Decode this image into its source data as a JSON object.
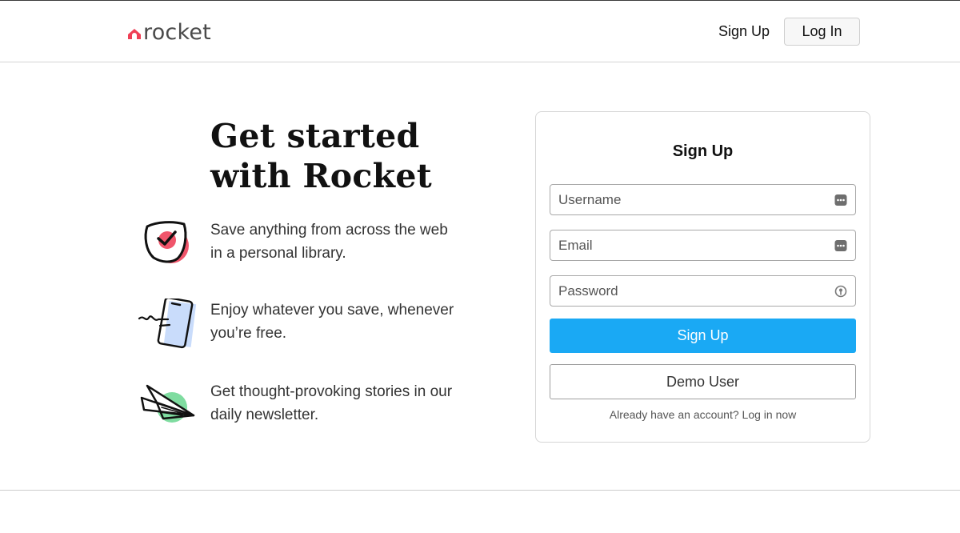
{
  "header": {
    "logo_text": "rocket",
    "nav_signup_label": "Sign Up",
    "nav_login_label": "Log In"
  },
  "hero": {
    "title_line1": "Get started",
    "title_line2": "with Rocket"
  },
  "features": [
    {
      "icon": "shield-check-icon",
      "text": "Save anything from across the web in a personal library."
    },
    {
      "icon": "phone-sketch-icon",
      "text": "Enjoy whatever you save, whenever you’re free."
    },
    {
      "icon": "paper-plane-icon",
      "text": "Get thought-provoking stories in our daily newsletter."
    }
  ],
  "form": {
    "title": "Sign Up",
    "username_placeholder": "Username",
    "email_placeholder": "Email",
    "password_placeholder": "Password",
    "submit_label": "Sign Up",
    "demo_label": "Demo User",
    "footer_text": "Already have an account? Log in now"
  },
  "colors": {
    "brand": "#ef4056",
    "primary_button": "#1aa9f4",
    "feature_pink": "#f0556b",
    "feature_blue": "#c9dcfb",
    "feature_green": "#7fdca0"
  }
}
